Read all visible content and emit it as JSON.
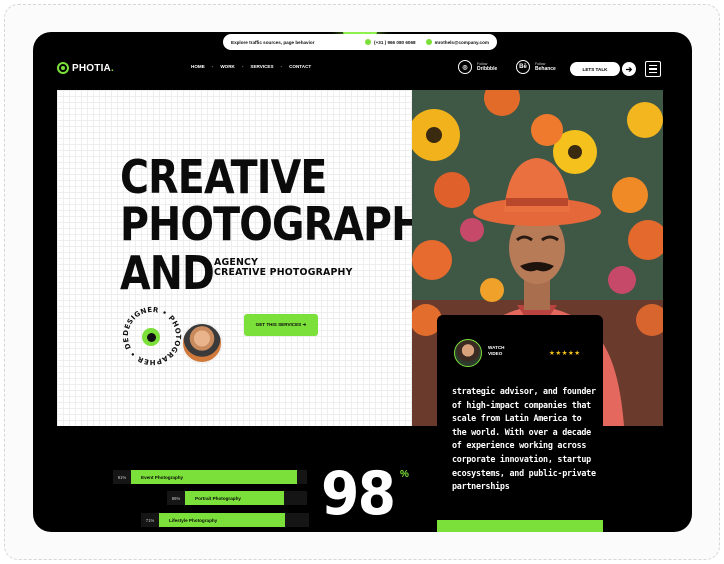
{
  "topbar": {
    "text": "Explore traffic sources, page behavior",
    "phone": "(+31 ) 966 080 6068",
    "email": "mrothels@company.com"
  },
  "brand": {
    "name": "PHOTIA",
    "accent": "#7ce03a"
  },
  "nav": {
    "items": [
      "HOME",
      "WORK",
      "SERVICES",
      "CONTACT"
    ]
  },
  "social": [
    {
      "icon": "dribbble-icon",
      "glyph": "◎",
      "caption": "Follow",
      "name": "Dribbble"
    },
    {
      "icon": "behance-icon",
      "glyph": "Bē",
      "caption": "Follow",
      "name": "Behance"
    }
  ],
  "header_cta": {
    "label": "LETS TALK",
    "arrow": "➔"
  },
  "hero": {
    "line1": "CREATIVE",
    "line2": "PHOTOGRAPHY",
    "line3": "AND",
    "sub1": "AGENCY",
    "sub2": "CREATIVE PHOTOGRAPHY",
    "badge_text": "DESIGNER • PHOTOGRAPHER • DESIGNER • ",
    "services_button": "GET THIS SERVICES ➔"
  },
  "testimonial": {
    "watch_label": "WATCH VIDEO",
    "stars": "★★★★★",
    "quote": "strategic advisor, and founder of high-impact companies that scale from Latin America to the world. With over a decade of experience working across corporate innovation, startup ecosystems, and public-private partnerships"
  },
  "skills": [
    {
      "pct": "91%",
      "label": "Event Photography",
      "value": 0.91
    },
    {
      "pct": "86%",
      "label": "Portrait Photography",
      "value": 0.86
    },
    {
      "pct": "71%",
      "label": "Lifestyle Photography",
      "value": 0.71
    }
  ],
  "stat": {
    "number": "98",
    "suffix": "%"
  }
}
